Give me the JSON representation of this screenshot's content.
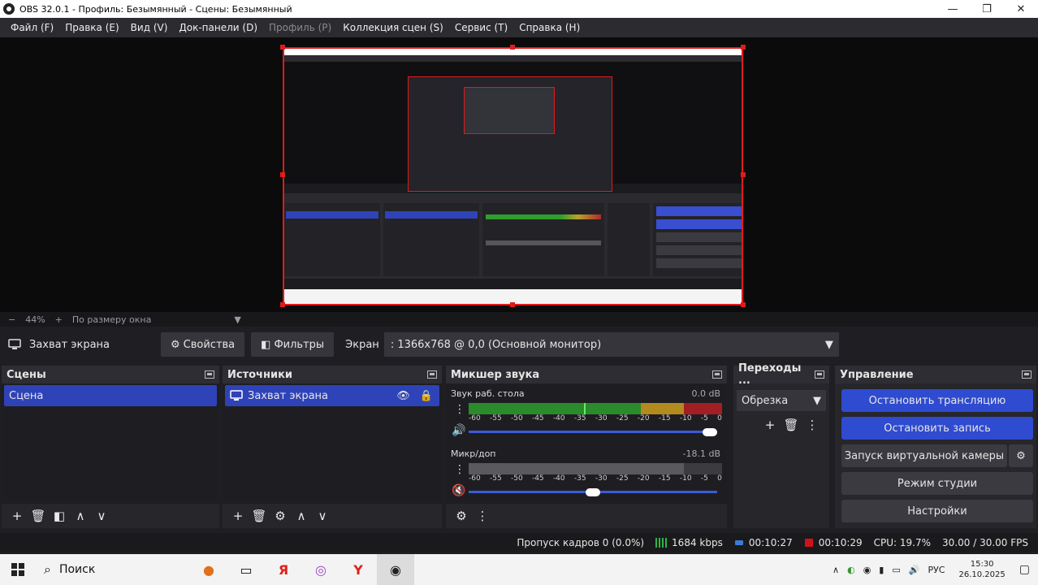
{
  "window": {
    "title": "OBS 32.0.1 - Профиль: Безымянный - Сцены: Безымянный",
    "minimize_glyph": "—",
    "maximize_glyph": "❐",
    "close_glyph": "✕"
  },
  "menu": {
    "file": "Файл (F)",
    "edit": "Правка (E)",
    "view": "Вид (V)",
    "docks": "Док-панели (D)",
    "profile": "Профиль (P)",
    "scene_collection": "Коллекция сцен (S)",
    "tools": "Сервис (T)",
    "help": "Справка (H)"
  },
  "zoom": {
    "minus": "−",
    "level": "44%",
    "plus": "+",
    "mode": "По размеру окна",
    "dropdown_glyph": "▼"
  },
  "source_toolbar": {
    "source_name": "Захват экрана",
    "properties_label": "Свойства",
    "filters_label": "Фильтры",
    "screen_label": "Экран",
    "screen_value": ": 1366x768 @ 0,0 (Основной монитор)"
  },
  "scenes": {
    "title": "Сцены",
    "items": [
      "Сцена"
    ]
  },
  "sources": {
    "title": "Источники",
    "items": [
      "Захват экрана"
    ]
  },
  "mixer": {
    "title": "Микшер звука",
    "channels": [
      {
        "name": "Звук раб. стола",
        "db": "0.0 dB",
        "volume": 1.0
      },
      {
        "name": "Микр/доп",
        "db": "-18.1 dB",
        "volume": 0.5
      }
    ],
    "ticks": [
      "-60",
      "-55",
      "-50",
      "-45",
      "-40",
      "-35",
      "-30",
      "-25",
      "-20",
      "-15",
      "-10",
      "-5",
      "0"
    ]
  },
  "transitions": {
    "title": "Переходы ...",
    "selected": "Обрезка"
  },
  "controls": {
    "title": "Управление",
    "stop_stream": "Остановить трансляцию",
    "stop_record": "Остановить запись",
    "virtual_cam": "Запуск виртуальной камеры",
    "studio_mode": "Режим студии",
    "settings": "Настройки"
  },
  "status": {
    "dropped_frames": "Пропуск кадров 0 (0.0%)",
    "bitrate": "1684 kbps",
    "stream_time": "00:10:27",
    "record_time": "00:10:29",
    "cpu": "CPU: 19.7%",
    "fps": "30.00 / 30.00 FPS"
  },
  "taskbar": {
    "search_label": "Поиск",
    "lang": "РУС",
    "time": "15:30",
    "date": "26.10.2025"
  },
  "colors": {
    "accent_blue": "#2f43b8",
    "selection_red": "#e01b1b",
    "record_red": "#d0121b"
  }
}
